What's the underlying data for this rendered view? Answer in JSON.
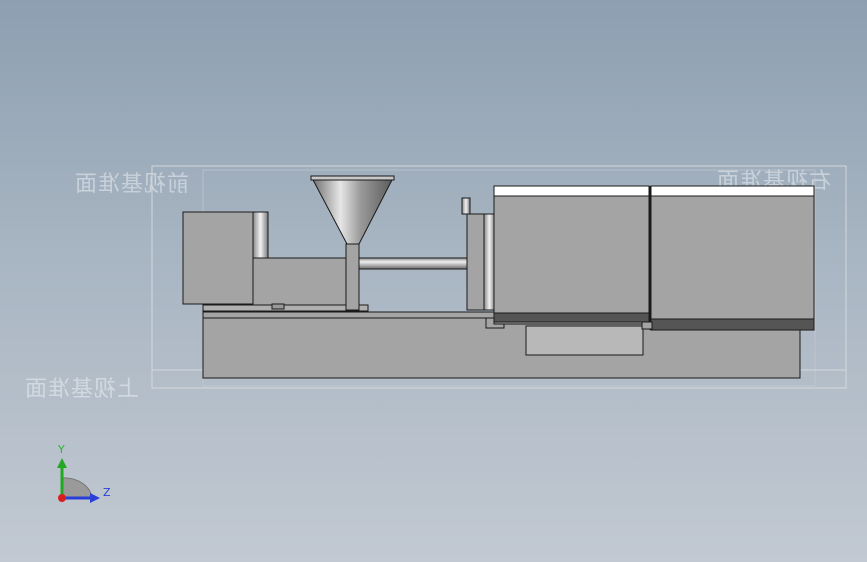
{
  "viewport": {
    "background_top": "#8d9fb1",
    "background_bottom": "#c2c9d2"
  },
  "planes": {
    "front": "前视基准面",
    "right": "右视基准面",
    "top": "上视基准面"
  },
  "triad": {
    "y_label": "Y",
    "z_label": "Z",
    "y_color": "#22a822",
    "z_color": "#2a3fd8",
    "x_color": "#d81f1f"
  },
  "model": {
    "body_color": "#a4a4a4",
    "edge_color": "#1a1a1a",
    "dark_band_color": "#555555"
  }
}
